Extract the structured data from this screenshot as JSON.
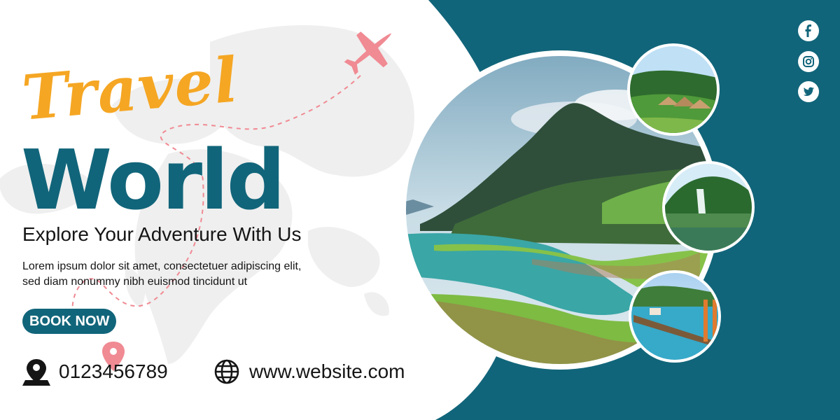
{
  "banner": {
    "script_title": "Travel",
    "main_title": "World",
    "tagline": "Explore Your Adventure With Us",
    "description": "Lorem ipsum dolor sit amet, consectetuer adipiscing elit, sed diam nonummy nibh euismod tincidunt ut",
    "cta_label": "BOOK NOW",
    "phone": "0123456789",
    "website": "www.website.com"
  },
  "social": [
    "facebook-icon",
    "instagram-icon",
    "twitter-icon"
  ],
  "colors": {
    "teal": "#11657a",
    "orange": "#f5a623",
    "pink": "#f08a93",
    "map_gray": "#efefef"
  }
}
